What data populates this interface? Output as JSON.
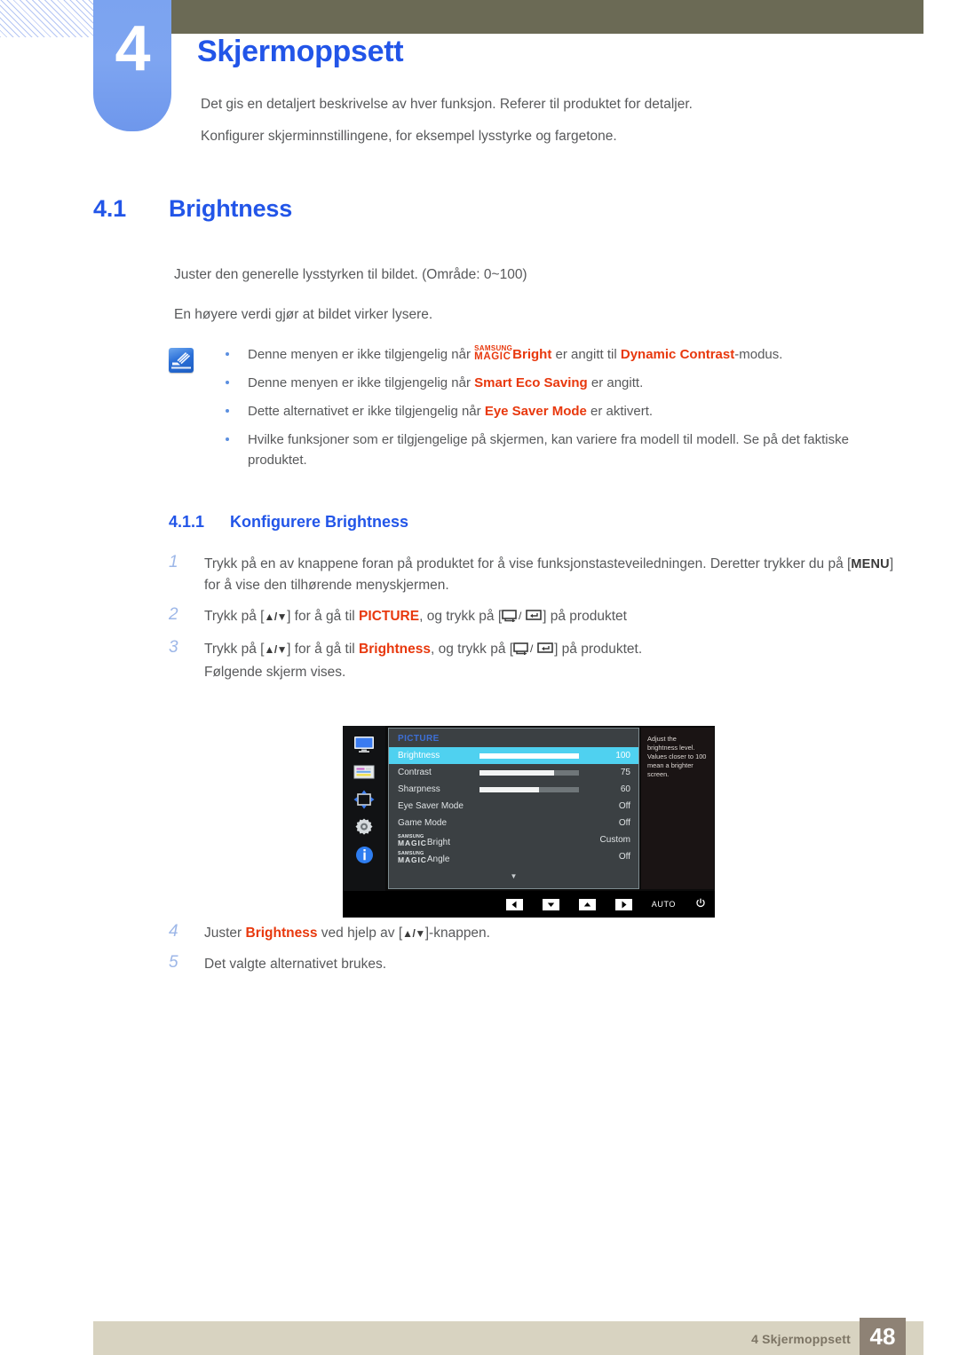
{
  "header": {
    "chapter_number": "4",
    "chapter_title": "Skjermoppsett",
    "intro_line_1": "Det gis en detaljert beskrivelse av hver funksjon. Referer til produktet for detaljer.",
    "intro_line_2": "Konfigurer skjerminnstillingene, for eksempel lysstyrke og fargetone."
  },
  "section": {
    "number": "4.1",
    "title": "Brightness",
    "body_1": "Juster den generelle lysstyrken til bildet. (Område: 0~100)",
    "body_2": "En høyere verdi gjør at bildet virker lysere."
  },
  "notes": {
    "icon": "note-pen-icon",
    "items": [
      {
        "pre": "Denne menyen er ikke tilgjengelig når ",
        "magic_small": "SAMSUNG",
        "magic_large": "MAGIC",
        "magic_suffix": "Bright",
        "mid": " er angitt til ",
        "highlight": "Dynamic Contrast",
        "post": "-modus."
      },
      {
        "pre": "Denne menyen er ikke tilgjengelig når ",
        "highlight": "Smart Eco Saving",
        "post": " er angitt."
      },
      {
        "pre": "Dette alternativet er ikke tilgjengelig når ",
        "highlight": "Eye Saver Mode",
        "post": " er aktivert."
      },
      {
        "pre": "Hvilke funksjoner som er tilgjengelige på skjermen, kan variere fra modell til modell. Se på det faktiske produktet."
      }
    ]
  },
  "subsection": {
    "number": "4.1.1",
    "title": "Konfigurere Brightness"
  },
  "steps": [
    {
      "n": "1",
      "a": "Trykk på en av knappene foran på produktet for å vise funksjonstasteveiledningen. Deretter trykker du på [",
      "key": "MENU",
      "b": "] for å vise den tilhørende menyskjermen."
    },
    {
      "n": "2",
      "a": "Trykk på [",
      "arrows": "▲/▼",
      "b": "] for å gå til ",
      "highlight": "PICTURE",
      "c": ", og trykk på [",
      "d": "] på produktet"
    },
    {
      "n": "3",
      "a": "Trykk på [",
      "arrows": "▲/▼",
      "b": "] for å gå til ",
      "highlight": "Brightness",
      "c": ", og trykk på [",
      "d": "] på produktet.",
      "extra": "Følgende skjerm vises."
    }
  ],
  "steps_after": [
    {
      "n": "4",
      "a": "Juster ",
      "highlight": "Brightness",
      "b": " ved hjelp av [",
      "arrows": "▲/▼",
      "c": "]-knappen."
    },
    {
      "n": "5",
      "a": "Det valgte alternativet brukes."
    }
  ],
  "osd": {
    "menu_title": "PICTURE",
    "rail_icons": [
      "monitor-icon",
      "osd-color-icon",
      "position-arrows-icon",
      "gear-icon",
      "info-icon"
    ],
    "rows": [
      {
        "label": "Brightness",
        "value": "100",
        "bar": 100,
        "selected": true
      },
      {
        "label": "Contrast",
        "value": "75",
        "bar": 75,
        "selected": false
      },
      {
        "label": "Sharpness",
        "value": "60",
        "bar": 60,
        "selected": false
      },
      {
        "label": "Eye Saver Mode",
        "value": "Off",
        "bar": null,
        "selected": false
      },
      {
        "label": "Game Mode",
        "value": "Off",
        "bar": null,
        "selected": false
      }
    ],
    "magic_rows": [
      {
        "small": "SAMSUNG",
        "large": "MAGIC",
        "suffix": "Bright",
        "value": "Custom"
      },
      {
        "small": "SAMSUNG",
        "large": "MAGIC",
        "suffix": "Angle",
        "value": "Off"
      }
    ],
    "scroll_caret": "▼",
    "help_text": "Adjust the brightness level. Values closer to 100 mean a brighter screen.",
    "footer_buttons": [
      "◀",
      "▼",
      "▲",
      "▶"
    ],
    "auto_label": "AUTO",
    "power_icon": "power-icon"
  },
  "footer": {
    "text": "4 Skjermoppsett",
    "page": "48"
  },
  "colors": {
    "accent_blue": "#2255e8",
    "highlight_red": "#e8380d",
    "olive": "#6b6a55",
    "footer_beige": "#d8d3c1",
    "footer_taupe": "#8e8275",
    "osd_cyan": "#4fd1f0"
  }
}
